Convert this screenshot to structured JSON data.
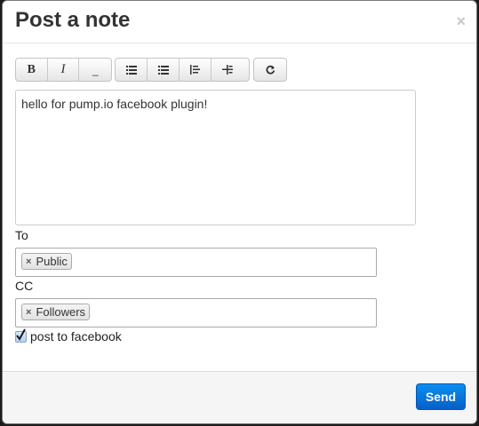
{
  "dialog": {
    "title": "Post a note",
    "close_glyph": "×"
  },
  "toolbar": {
    "groups": [
      [
        {
          "name": "bold",
          "label": "B"
        },
        {
          "name": "italic",
          "label": "I"
        },
        {
          "name": "underline",
          "label": "_"
        }
      ],
      [
        {
          "name": "unordered-list",
          "icon": "unordered-list-icon"
        },
        {
          "name": "ordered-list",
          "icon": "ordered-list-icon"
        },
        {
          "name": "outdent",
          "icon": "outdent-icon"
        },
        {
          "name": "indent",
          "icon": "indent-icon"
        }
      ],
      [
        {
          "name": "redo",
          "icon": "redo-icon"
        }
      ]
    ]
  },
  "editor": {
    "content": "hello for pump.io facebook plugin!"
  },
  "to": {
    "label": "To",
    "tags": [
      {
        "remove": "×",
        "text": "Public"
      }
    ]
  },
  "cc": {
    "label": "CC",
    "tags": [
      {
        "remove": "×",
        "text": "Followers"
      }
    ]
  },
  "facebook": {
    "label": "post to facebook",
    "checked": true
  },
  "footer": {
    "send_label": "Send"
  },
  "colors": {
    "primary": "#0a6fe0",
    "backdrop": "#1b1b1b"
  }
}
